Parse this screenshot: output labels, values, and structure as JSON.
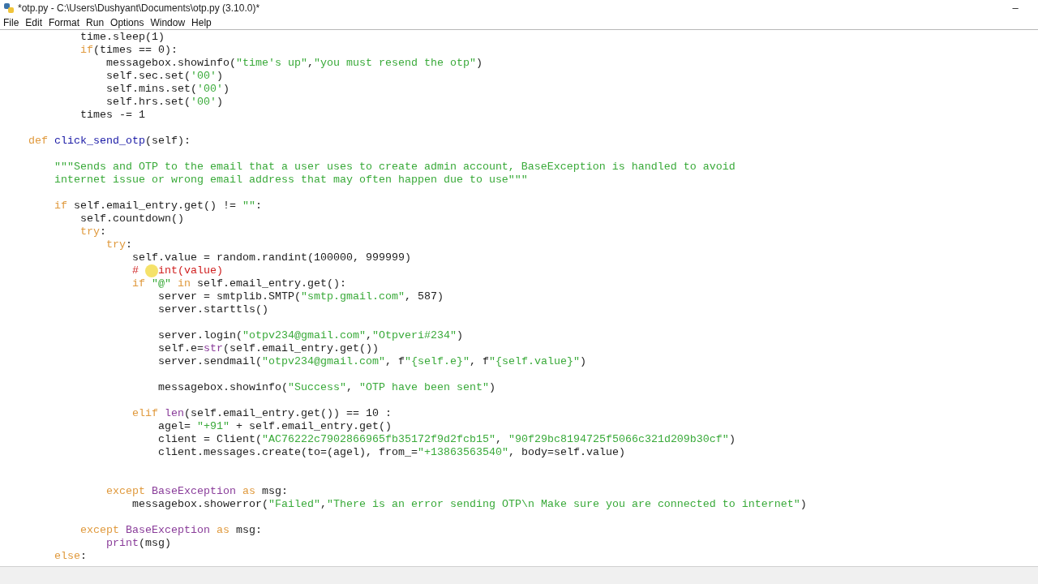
{
  "window": {
    "title": "*otp.py - C:\\Users\\Dushyant\\Documents\\otp.py (3.10.0)*",
    "minimize": "–"
  },
  "menu": [
    {
      "label": "File"
    },
    {
      "label": "Edit"
    },
    {
      "label": "Format"
    },
    {
      "label": "Run"
    },
    {
      "label": "Options"
    },
    {
      "label": "Window"
    },
    {
      "label": "Help"
    }
  ],
  "editor": {
    "lines": [
      {
        "kind": "block",
        "children": [
          {
            "kind": "block",
            "children": [
              {
                "kind": "block",
                "children": [
                  {
                    "kind": "code",
                    "tokens": [
                      {
                        "kind": "plain",
                        "text": "time.sleep(1)"
                      }
                    ]
                  },
                  {
                    "kind": "code",
                    "tokens": [
                      {
                        "kind": "keyword",
                        "text": "if"
                      },
                      {
                        "kind": "plain",
                        "text": "(times == 0):"
                      }
                    ],
                    "children": [
                      {
                        "kind": "code",
                        "tokens": [
                          {
                            "kind": "plain",
                            "text": "messagebox.showinfo("
                          },
                          {
                            "kind": "string",
                            "text": "\"time's up\""
                          },
                          {
                            "kind": "plain",
                            "text": ","
                          },
                          {
                            "kind": "string",
                            "text": "\"you must resend the otp\""
                          },
                          {
                            "kind": "plain",
                            "text": ")"
                          }
                        ]
                      },
                      {
                        "kind": "code",
                        "tokens": [
                          {
                            "kind": "plain",
                            "text": "self.sec.set("
                          },
                          {
                            "kind": "string",
                            "text": "'00'"
                          },
                          {
                            "kind": "plain",
                            "text": ")"
                          }
                        ]
                      },
                      {
                        "kind": "code",
                        "tokens": [
                          {
                            "kind": "plain",
                            "text": "self.mins.set("
                          },
                          {
                            "kind": "string",
                            "text": "'00'"
                          },
                          {
                            "kind": "plain",
                            "text": ")"
                          }
                        ]
                      },
                      {
                        "kind": "code",
                        "tokens": [
                          {
                            "kind": "plain",
                            "text": "self.hrs.set("
                          },
                          {
                            "kind": "string",
                            "text": "'00'"
                          },
                          {
                            "kind": "plain",
                            "text": ")"
                          }
                        ]
                      }
                    ]
                  },
                  {
                    "kind": "code",
                    "tokens": [
                      {
                        "kind": "plain",
                        "text": "times -= 1"
                      }
                    ]
                  }
                ]
              }
            ]
          },
          {
            "kind": "blank"
          },
          {
            "kind": "code",
            "tokens": [
              {
                "kind": "keyword",
                "text": "def "
              },
              {
                "kind": "defname",
                "text": "click_send_otp"
              },
              {
                "kind": "plain",
                "text": "(self):"
              }
            ],
            "children": [
              {
                "kind": "blank"
              },
              {
                "kind": "code",
                "tokens": [
                  {
                    "kind": "string",
                    "text": "\"\"\"Sends and OTP to the email that a user uses to create admin account, BaseException is handled to avoid"
                  }
                ]
              },
              {
                "kind": "code",
                "tokens": [
                  {
                    "kind": "string",
                    "text": "internet issue or wrong email address that may often happen due to use\"\"\""
                  }
                ]
              },
              {
                "kind": "blank"
              },
              {
                "kind": "code",
                "tokens": [
                  {
                    "kind": "keyword",
                    "text": "if"
                  },
                  {
                    "kind": "plain",
                    "text": " self.email_entry.get() != "
                  },
                  {
                    "kind": "string",
                    "text": "\"\""
                  },
                  {
                    "kind": "plain",
                    "text": ":"
                  }
                ],
                "children": [
                  {
                    "kind": "code",
                    "tokens": [
                      {
                        "kind": "plain",
                        "text": "self.countdown()"
                      }
                    ]
                  },
                  {
                    "kind": "code",
                    "tokens": [
                      {
                        "kind": "keyword",
                        "text": "try"
                      },
                      {
                        "kind": "plain",
                        "text": ":"
                      }
                    ],
                    "children": [
                      {
                        "kind": "code",
                        "tokens": [
                          {
                            "kind": "keyword",
                            "text": "try"
                          },
                          {
                            "kind": "plain",
                            "text": ":"
                          }
                        ],
                        "children": [
                          {
                            "kind": "code",
                            "tokens": [
                              {
                                "kind": "plain",
                                "text": "self.value = random.randint(100000, 999999)"
                              }
                            ]
                          },
                          {
                            "kind": "code",
                            "tokens": [
                              {
                                "kind": "comment",
                                "text": "# "
                              },
                              {
                                "kind": "cursor"
                              },
                              {
                                "kind": "comment",
                                "text": "int(value)"
                              }
                            ]
                          },
                          {
                            "kind": "code",
                            "tokens": [
                              {
                                "kind": "keyword",
                                "text": "if "
                              },
                              {
                                "kind": "string",
                                "text": "\"@\""
                              },
                              {
                                "kind": "keyword",
                                "text": " in"
                              },
                              {
                                "kind": "plain",
                                "text": " self.email_entry.get():"
                              }
                            ],
                            "children": [
                              {
                                "kind": "code",
                                "tokens": [
                                  {
                                    "kind": "plain",
                                    "text": "server = smtplib.SMTP("
                                  },
                                  {
                                    "kind": "string",
                                    "text": "\"smtp.gmail.com\""
                                  },
                                  {
                                    "kind": "plain",
                                    "text": ", 587)"
                                  }
                                ]
                              },
                              {
                                "kind": "code",
                                "tokens": [
                                  {
                                    "kind": "plain",
                                    "text": "server.starttls()"
                                  }
                                ]
                              },
                              {
                                "kind": "blank"
                              },
                              {
                                "kind": "code",
                                "tokens": [
                                  {
                                    "kind": "plain",
                                    "text": "server.login("
                                  },
                                  {
                                    "kind": "string",
                                    "text": "\"otpv234@gmail.com\""
                                  },
                                  {
                                    "kind": "plain",
                                    "text": ","
                                  },
                                  {
                                    "kind": "string",
                                    "text": "\"Otpveri#234\""
                                  },
                                  {
                                    "kind": "plain",
                                    "text": ")"
                                  }
                                ]
                              },
                              {
                                "kind": "code",
                                "tokens": [
                                  {
                                    "kind": "plain",
                                    "text": "self.e="
                                  },
                                  {
                                    "kind": "builtin",
                                    "text": "str"
                                  },
                                  {
                                    "kind": "plain",
                                    "text": "(self.email_entry.get())"
                                  }
                                ]
                              },
                              {
                                "kind": "code",
                                "tokens": [
                                  {
                                    "kind": "plain",
                                    "text": "server.sendmail("
                                  },
                                  {
                                    "kind": "string",
                                    "text": "\"otpv234@gmail.com\""
                                  },
                                  {
                                    "kind": "plain",
                                    "text": ", f"
                                  },
                                  {
                                    "kind": "string",
                                    "text": "\"{self.e}\""
                                  },
                                  {
                                    "kind": "plain",
                                    "text": ", f"
                                  },
                                  {
                                    "kind": "string",
                                    "text": "\"{self.value}\""
                                  },
                                  {
                                    "kind": "plain",
                                    "text": ")"
                                  }
                                ]
                              },
                              {
                                "kind": "blank"
                              },
                              {
                                "kind": "code",
                                "tokens": [
                                  {
                                    "kind": "plain",
                                    "text": "messagebox.showinfo("
                                  },
                                  {
                                    "kind": "string",
                                    "text": "\"Success\""
                                  },
                                  {
                                    "kind": "plain",
                                    "text": ", "
                                  },
                                  {
                                    "kind": "string",
                                    "text": "\"OTP have been sent\""
                                  },
                                  {
                                    "kind": "plain",
                                    "text": ")"
                                  }
                                ]
                              },
                              {
                                "kind": "blank"
                              }
                            ]
                          },
                          {
                            "kind": "code",
                            "tokens": [
                              {
                                "kind": "keyword",
                                "text": "elif "
                              },
                              {
                                "kind": "builtin",
                                "text": "len"
                              },
                              {
                                "kind": "plain",
                                "text": "(self.email_entry.get()) == 10 :"
                              }
                            ],
                            "children": [
                              {
                                "kind": "code",
                                "tokens": [
                                  {
                                    "kind": "plain",
                                    "text": "agel= "
                                  },
                                  {
                                    "kind": "string",
                                    "text": "\"+91\""
                                  },
                                  {
                                    "kind": "plain",
                                    "text": " + self.email_entry.get()"
                                  }
                                ]
                              },
                              {
                                "kind": "code",
                                "tokens": [
                                  {
                                    "kind": "plain",
                                    "text": "client = Client("
                                  },
                                  {
                                    "kind": "string",
                                    "text": "\"AC76222c7902866965fb35172f9d2fcb15\""
                                  },
                                  {
                                    "kind": "plain",
                                    "text": ", "
                                  },
                                  {
                                    "kind": "string",
                                    "text": "\"90f29bc8194725f5066c321d209b30cf\""
                                  },
                                  {
                                    "kind": "plain",
                                    "text": ")"
                                  }
                                ]
                              },
                              {
                                "kind": "code",
                                "tokens": [
                                  {
                                    "kind": "plain",
                                    "text": "client.messages.create(to=(agel), from_="
                                  },
                                  {
                                    "kind": "string",
                                    "text": "\"+13863563540\""
                                  },
                                  {
                                    "kind": "plain",
                                    "text": ", body=self.value)"
                                  }
                                ]
                              },
                              {
                                "kind": "blank"
                              },
                              {
                                "kind": "blank"
                              }
                            ]
                          }
                        ]
                      },
                      {
                        "kind": "code",
                        "tokens": [
                          {
                            "kind": "keyword",
                            "text": "except "
                          },
                          {
                            "kind": "builtin",
                            "text": "BaseException"
                          },
                          {
                            "kind": "keyword",
                            "text": " as"
                          },
                          {
                            "kind": "plain",
                            "text": " msg:"
                          }
                        ],
                        "children": [
                          {
                            "kind": "code",
                            "tokens": [
                              {
                                "kind": "plain",
                                "text": "messagebox.showerror("
                              },
                              {
                                "kind": "string",
                                "text": "\"Failed\""
                              },
                              {
                                "kind": "plain",
                                "text": ","
                              },
                              {
                                "kind": "string",
                                "text": "\"There is an error sending OTP\\n Make sure you are connected to internet\""
                              },
                              {
                                "kind": "plain",
                                "text": ")"
                              }
                            ]
                          },
                          {
                            "kind": "blank"
                          }
                        ]
                      }
                    ]
                  },
                  {
                    "kind": "code",
                    "tokens": [
                      {
                        "kind": "keyword",
                        "text": "except "
                      },
                      {
                        "kind": "builtin",
                        "text": "BaseException"
                      },
                      {
                        "kind": "keyword",
                        "text": " as"
                      },
                      {
                        "kind": "plain",
                        "text": " msg:"
                      }
                    ],
                    "children": [
                      {
                        "kind": "code",
                        "tokens": [
                          {
                            "kind": "builtin",
                            "text": "print"
                          },
                          {
                            "kind": "plain",
                            "text": "(msg)"
                          }
                        ]
                      }
                    ]
                  }
                ]
              },
              {
                "kind": "code",
                "tokens": [
                  {
                    "kind": "keyword",
                    "text": "else"
                  },
                  {
                    "kind": "plain",
                    "text": ":"
                  }
                ]
              }
            ]
          }
        ]
      }
    ]
  }
}
